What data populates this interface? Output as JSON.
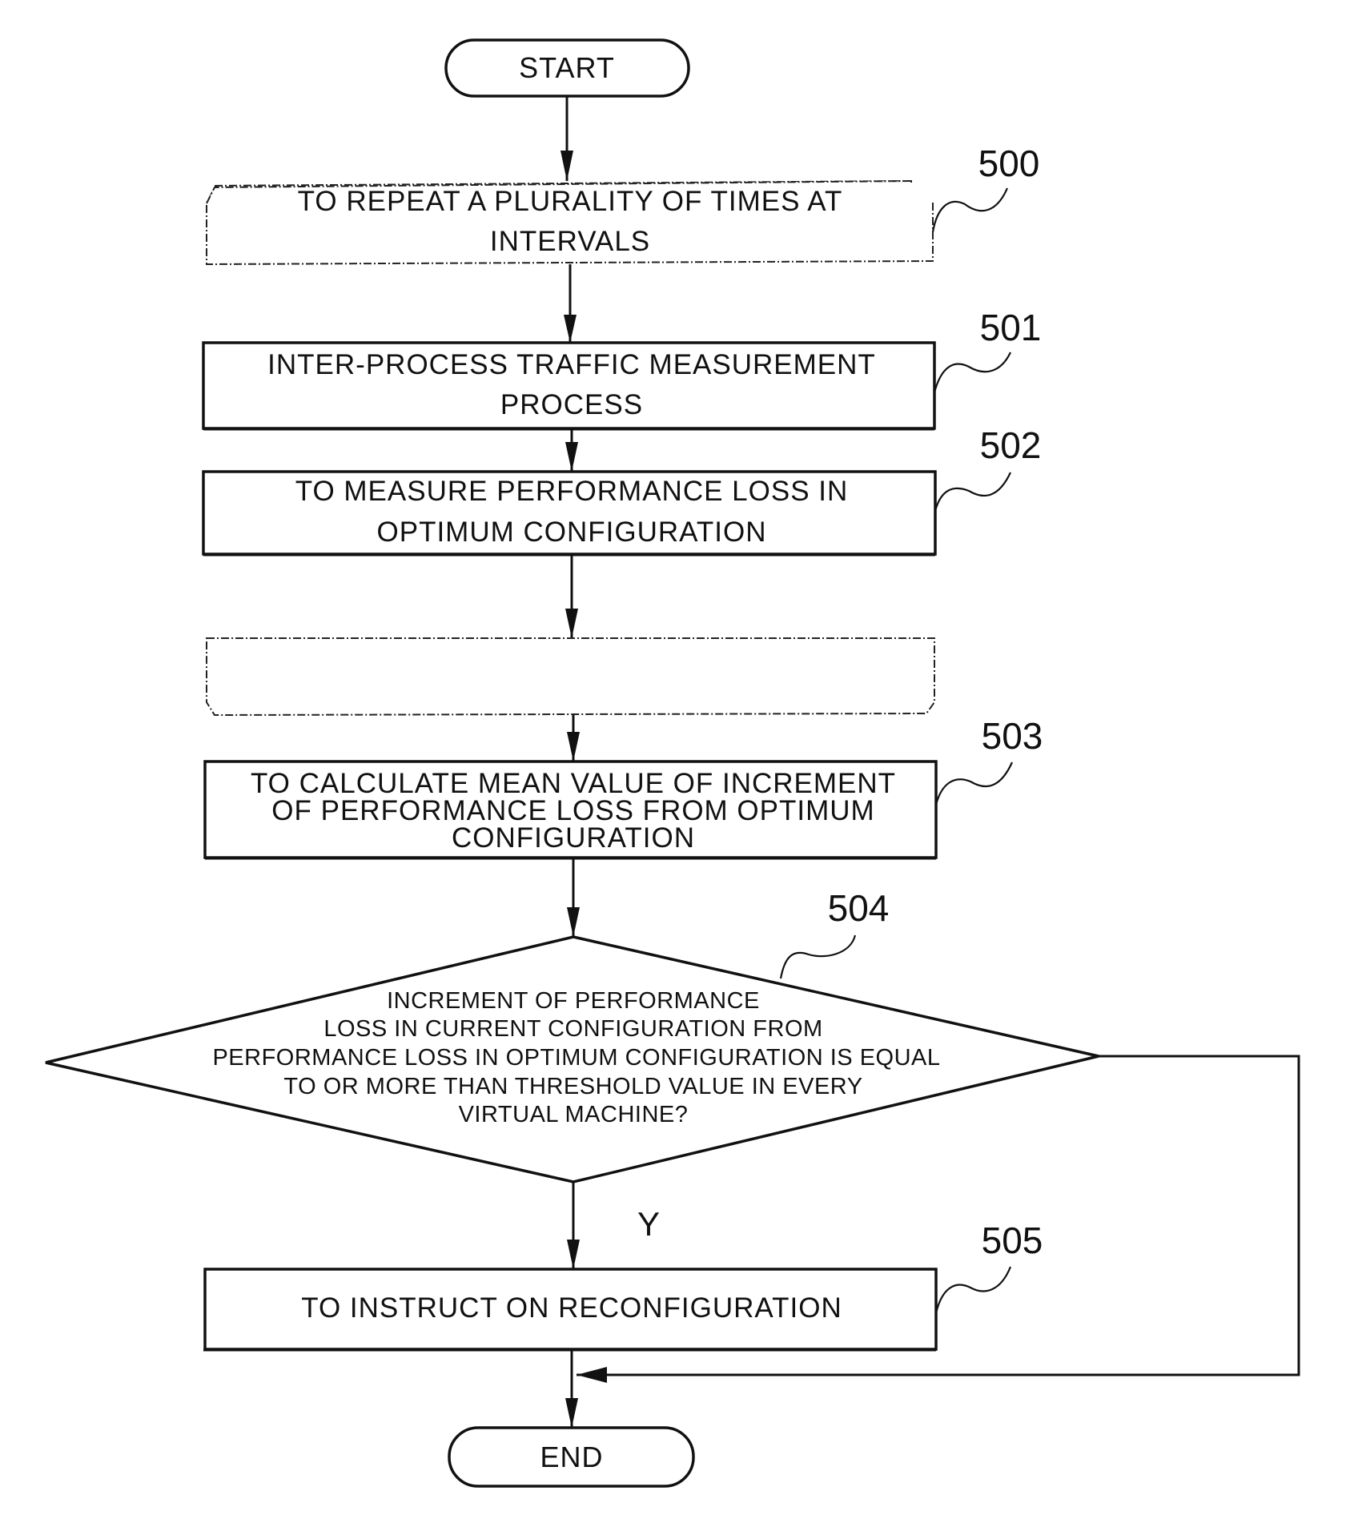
{
  "diagram": {
    "type": "flowchart",
    "start": {
      "label": "START"
    },
    "end": {
      "label": "END"
    },
    "loop": {
      "ref": "500",
      "label_lines": [
        "TO REPEAT A PLURALITY OF TIMES AT",
        "INTERVALS"
      ]
    },
    "steps": [
      {
        "ref": "501",
        "label_lines": [
          "INTER-PROCESS TRAFFIC MEASUREMENT",
          "PROCESS"
        ]
      },
      {
        "ref": "502",
        "label_lines": [
          "TO MEASURE PERFORMANCE LOSS IN",
          "OPTIMUM CONFIGURATION"
        ]
      },
      {
        "ref": "503",
        "label_lines": [
          "TO CALCULATE MEAN VALUE OF INCREMENT",
          "OF PERFORMANCE LOSS FROM OPTIMUM",
          "CONFIGURATION"
        ]
      },
      {
        "ref": "505",
        "label_lines": [
          "TO INSTRUCT ON RECONFIGURATION"
        ]
      }
    ],
    "decision": {
      "ref": "504",
      "label_lines": [
        "INCREMENT OF PERFORMANCE",
        "LOSS IN CURRENT CONFIGURATION FROM",
        "PERFORMANCE LOSS IN OPTIMUM CONFIGURATION IS EQUAL",
        "TO OR MORE THAN THRESHOLD VALUE IN EVERY",
        "VIRTUAL MACHINE?"
      ],
      "yes_label": "Y"
    }
  }
}
